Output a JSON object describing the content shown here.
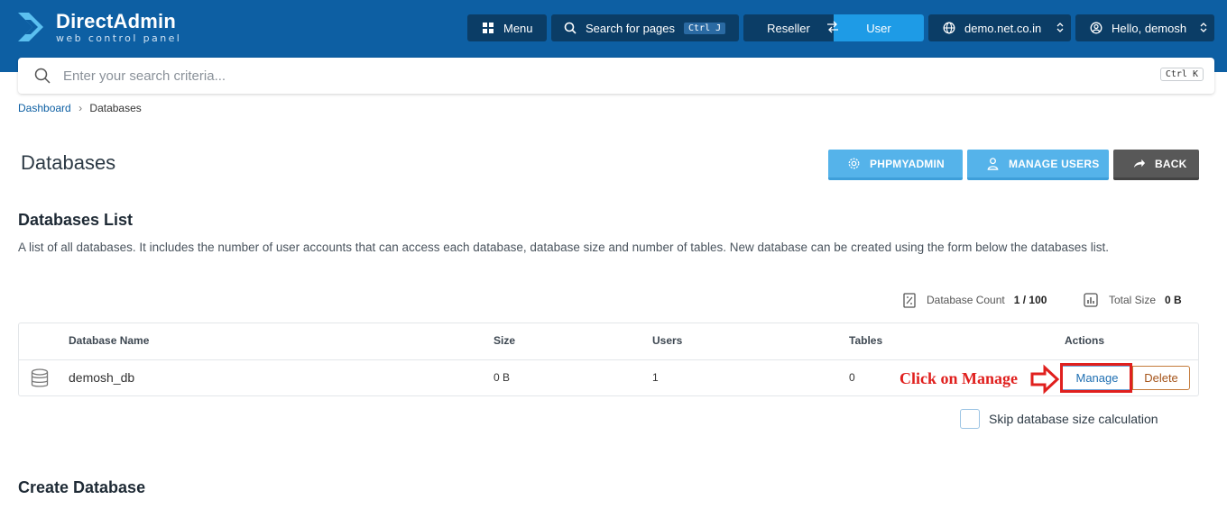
{
  "app": {
    "name": "DirectAdmin",
    "tagline": "web control panel"
  },
  "topbar": {
    "menu_label": "Menu",
    "search_label": "Search for pages",
    "search_shortcut": "Ctrl J",
    "role_reseller": "Reseller",
    "role_user": "User",
    "domain": "demo.net.co.in",
    "greeting": "Hello, demosh"
  },
  "search": {
    "placeholder": "Enter your search criteria...",
    "shortcut": "Ctrl K"
  },
  "breadcrumb": {
    "home": "Dashboard",
    "current": "Databases"
  },
  "page": {
    "title": "Databases",
    "buttons": {
      "phpmyadmin": "PHPMYADMIN",
      "manage_users": "MANAGE USERS",
      "back": "BACK"
    }
  },
  "list": {
    "title": "Databases List",
    "description": "A list of all databases. It includes the number of user accounts that can access each database, database size and number of tables. New database can be created using the form below the databases list.",
    "stats": {
      "count_label": "Database Count",
      "count_value": "1 / 100",
      "size_label": "Total Size",
      "size_value": "0 B"
    },
    "columns": {
      "name": "Database Name",
      "size": "Size",
      "users": "Users",
      "tables": "Tables",
      "actions": "Actions"
    },
    "rows": [
      {
        "name": "demosh_db",
        "size": "0 B",
        "users": "1",
        "tables": "0",
        "manage": "Manage",
        "delete": "Delete"
      }
    ],
    "skip_label": "Skip database size calculation"
  },
  "annotation": {
    "text": "Click on Manage",
    "color": "#e0201e"
  },
  "create": {
    "title": "Create Database"
  },
  "colors": {
    "header": "#0d5fa3",
    "header_button": "#0b3d66",
    "accent_light": "#55b3ea",
    "back_button": "#585858"
  }
}
